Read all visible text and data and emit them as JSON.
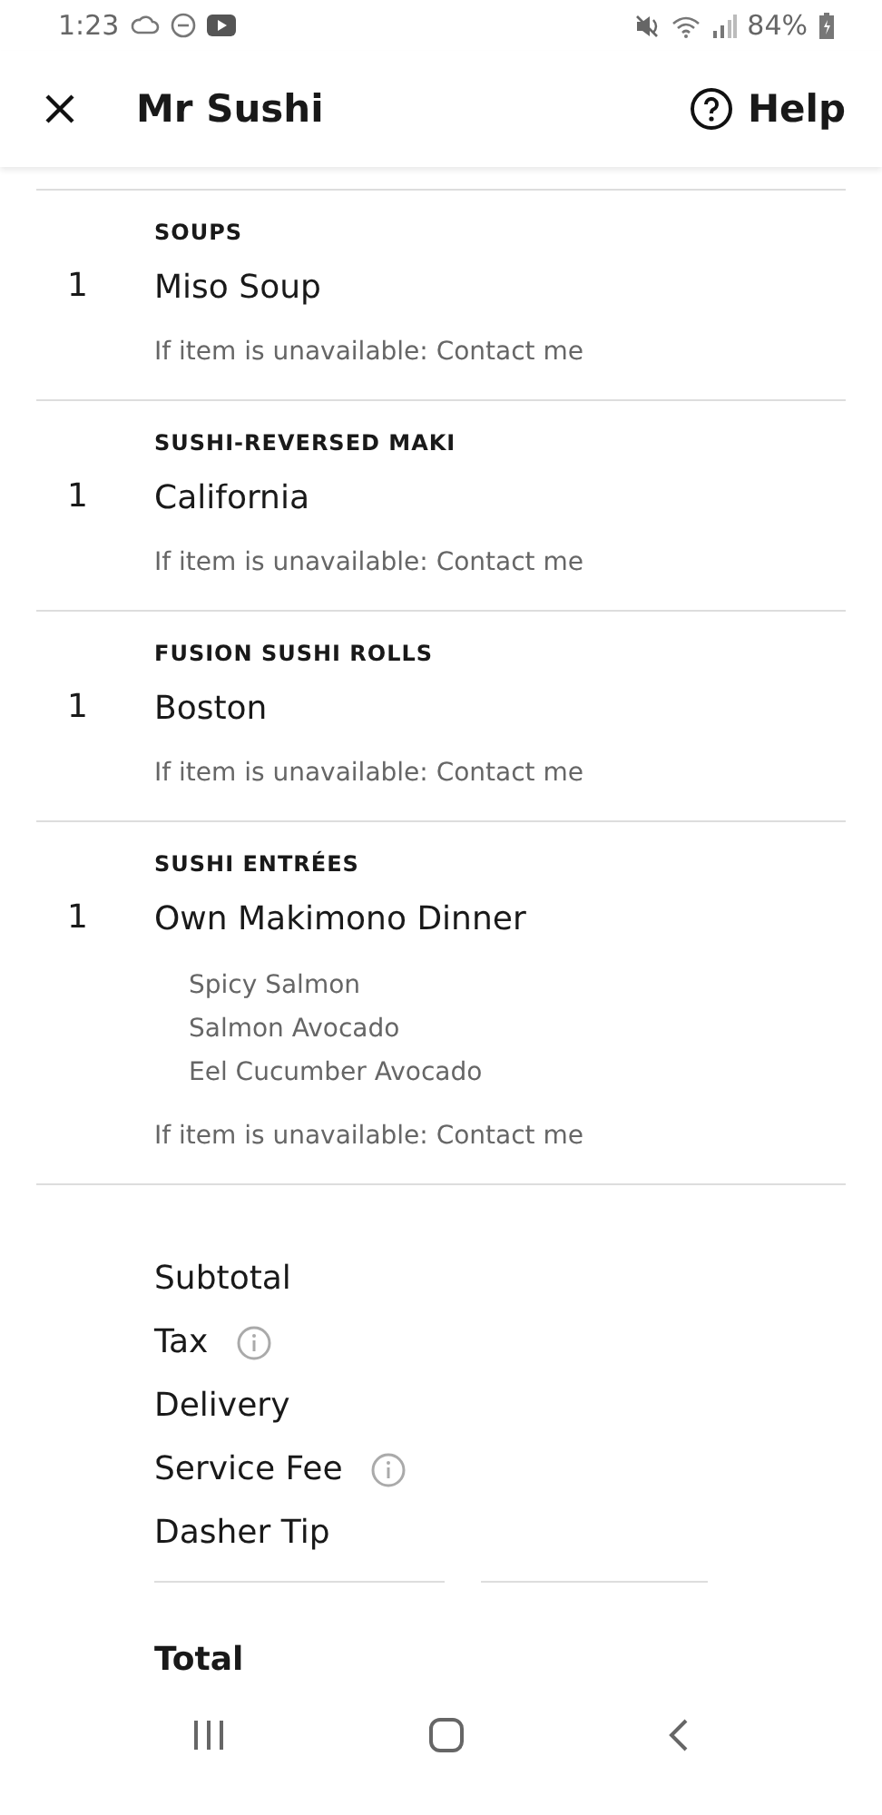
{
  "status_bar": {
    "time": "1:23",
    "battery": "84%"
  },
  "header": {
    "title": "Mr Sushi",
    "help": "Help"
  },
  "items": [
    {
      "category": "SOUPS",
      "quantity": "1",
      "name": "Miso Soup",
      "note": "If item is unavailable: Contact me"
    },
    {
      "category": "SUSHI-REVERSED MAKI",
      "quantity": "1",
      "name": "California",
      "note": "If item is unavailable: Contact me"
    },
    {
      "category": "FUSION SUSHI ROLLS",
      "quantity": "1",
      "name": "Boston",
      "note": "If item is unavailable: Contact me"
    },
    {
      "category": "SUSHI ENTRÉES",
      "quantity": "1",
      "name": "Own Makimono Dinner",
      "options": [
        "Spicy Salmon",
        "Salmon Avocado",
        "Eel Cucumber Avocado"
      ],
      "note": "If item is unavailable: Contact me"
    }
  ],
  "fees": [
    {
      "label": "Subtotal",
      "info": false
    },
    {
      "label": "Tax",
      "info": true
    },
    {
      "label": "Delivery",
      "info": false
    },
    {
      "label": "Service Fee",
      "info": true
    },
    {
      "label": "Dasher Tip",
      "info": false
    }
  ],
  "total": {
    "label": "Total"
  }
}
